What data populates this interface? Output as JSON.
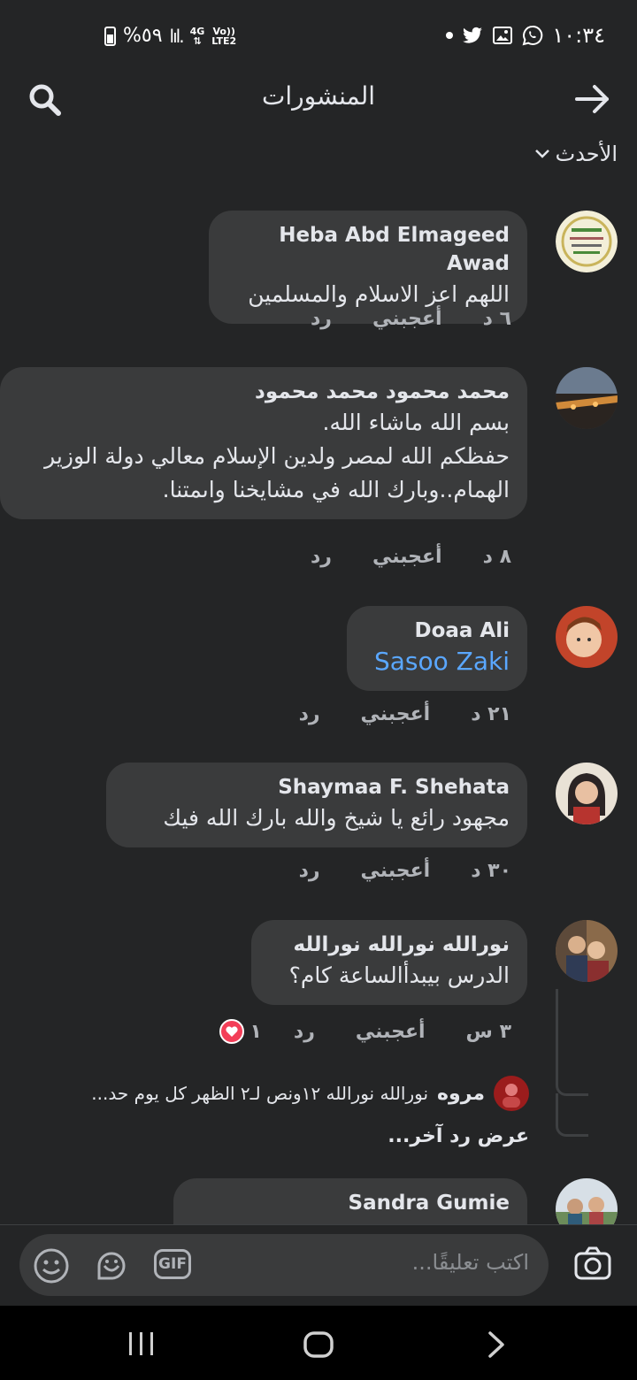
{
  "status_bar": {
    "time": "١٠:٣٤",
    "battery": "%٥٩",
    "network_top": "4G",
    "network_mid": "Vo))",
    "network_bottom": "LTE2"
  },
  "header": {
    "title": "المنشورات",
    "sort_label": "الأحدث"
  },
  "comments": [
    {
      "author": "Heba Abd Elmageed Awad",
      "lines": [
        "اللهم اعز الاسلام والمسلمين"
      ],
      "time": "٦ د",
      "like": "أعجبني",
      "reply": "رد"
    },
    {
      "author": "محمد محمود محمد محمود",
      "lines": [
        "بسم الله ماشاء الله.",
        "حفظكم الله لمصر ولدين الإسلام معالي دولة الوزير",
        "الهمام..وبارك الله في مشايخنا واىمتنا."
      ],
      "time": "٨ د",
      "like": "أعجبني",
      "reply": "رد"
    },
    {
      "author": "Doaa Ali",
      "mention": "Sasoo Zaki",
      "time": "٢١ د",
      "like": "أعجبني",
      "reply": "رد"
    },
    {
      "author": "Shaymaa F. Shehata",
      "lines": [
        "مجهود رائع يا شيخ والله بارك الله فيك"
      ],
      "time": "٣٠ د",
      "like": "أعجبني",
      "reply": "رد"
    },
    {
      "author": "نورالله نورالله نورالله",
      "lines": [
        "الدرس بيبدأالساعة كام؟"
      ],
      "time": "٣ س",
      "like": "أعجبني",
      "reply": "رد",
      "reaction_count": "١",
      "reply_preview": {
        "author": "مروه",
        "text": "نورالله نورالله ١٢ونص لـ٢ الظهر كل يوم حد..."
      },
      "more_replies": "عرض رد آخر..."
    },
    {
      "author": "Sandra Gumie"
    }
  ],
  "composer": {
    "placeholder": "اكتب تعليقًا...",
    "gif_label": "GIF"
  },
  "colors": {
    "background": "#242526",
    "bubble": "#3a3b3c",
    "link": "#5aa7ff",
    "heart": "#f33e58"
  }
}
